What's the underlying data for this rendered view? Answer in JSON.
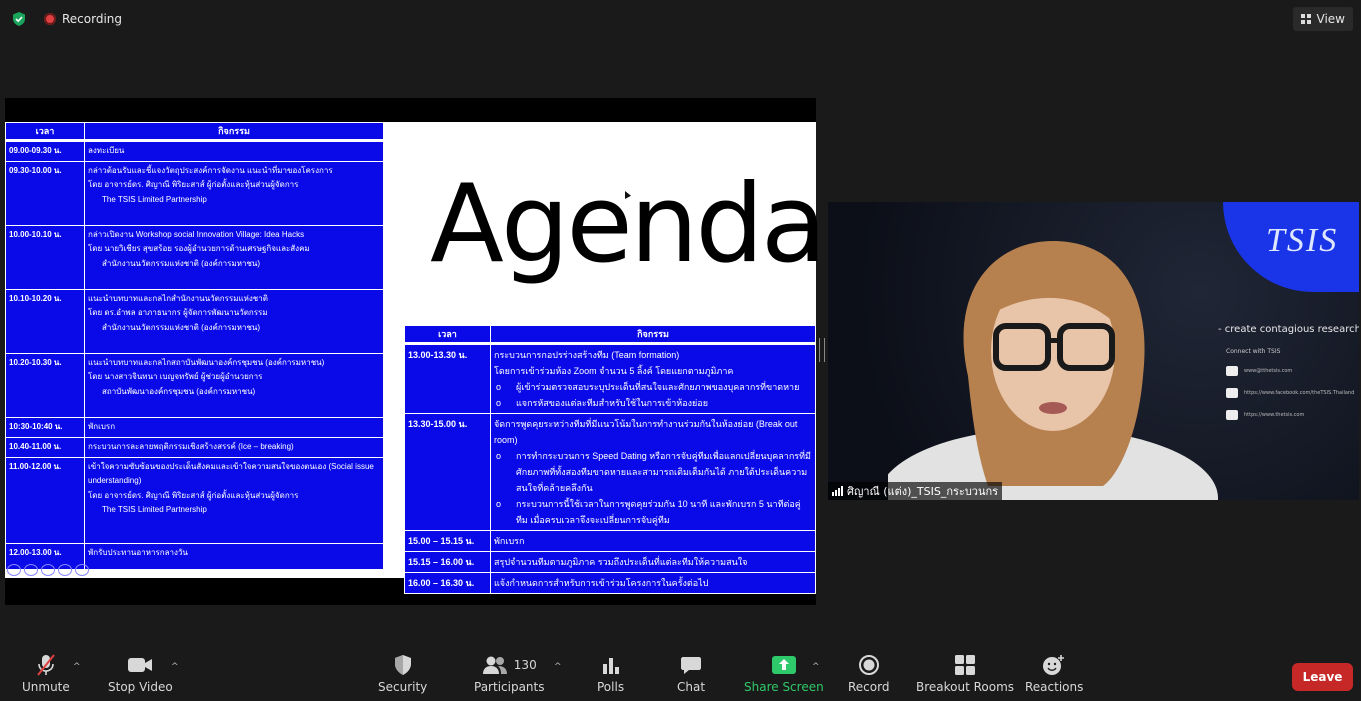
{
  "topbar": {
    "recording": "Recording",
    "view": "View"
  },
  "colors": {
    "accent_green": "#2ec96a",
    "leave_red": "#c62828",
    "slide_blue": "#0a0ae8"
  },
  "slide": {
    "title": "Agenda",
    "left_table": {
      "headers": [
        "เวลา",
        "กิจกรรม"
      ],
      "rows": [
        {
          "time": "09.00-09.30 น.",
          "lines": [
            "ลงทะเบียน"
          ],
          "indent": []
        },
        {
          "time": "09.30-10.00 น.",
          "lines": [
            "กล่าวต้อนรับและชี้แจงวัตถุประสงค์การจัดงาน แนะนำที่มาของโครงการ",
            "โดย อาจารย์ดร. ศิญาณี พิริยะสาส์ ผู้ก่อตั้งและหุ้นส่วนผู้จัดการ"
          ],
          "indent": [
            "The TSIS Limited Partnership"
          ]
        },
        {
          "time": "10.00-10.10 น.",
          "lines": [
            "กล่าวเปิดงาน Workshop social Innovation Village: Idea Hacks",
            "โดย นายวิเชียร สุขสร้อย รองผู้อำนวยการด้านเศรษฐกิจและสังคม"
          ],
          "indent": [
            "สำนักงานนวัตกรรมแห่งชาติ (องค์การมหาชน)"
          ]
        },
        {
          "time": "10.10-10.20 น.",
          "lines": [
            "แนะนำบทบาทและกลไกสำนักงานนวัตกรรมแห่งชาติ",
            "โดย ดร.อำพล อาภาธนากร ผู้จัดการพัฒนานวัตกรรม"
          ],
          "indent": [
            "สำนักงานนวัตกรรมแห่งชาติ (องค์การมหาชน)"
          ]
        },
        {
          "time": "10.20-10.30 น.",
          "lines": [
            "แนะนำบทบาทและกลไกสถาบันพัฒนาองค์กรชุมชน (องค์การมหาชน)",
            "โดย นางสาวจินทนา เบญจทรัพย์ ผู้ช่วยผู้อำนวยการ"
          ],
          "indent": [
            "สถาบันพัฒนาองค์กรชุมชน (องค์การมหาชน)"
          ]
        },
        {
          "time": "10:30-10:40 น.",
          "lines": [
            "พักเบรก"
          ],
          "indent": []
        },
        {
          "time": "10.40-11.00 น.",
          "lines": [
            "กระบวนการละลายพฤติกรรมเชิงสร้างสรรค์ (Ice – breaking)"
          ],
          "indent": []
        },
        {
          "time": "11.00-12.00 น.",
          "lines": [
            "เข้าใจความซับซ้อนของประเด็นสังคมและเข้าใจความสนใจของตนเอง (Social issue understanding)",
            "โดย อาจารย์ดร. ศิญาณี พิริยะสาส์ ผู้ก่อตั้งและหุ้นส่วนผู้จัดการ"
          ],
          "indent": [
            "The TSIS Limited Partnership"
          ]
        },
        {
          "time": "12.00-13.00 น.",
          "lines": [
            "พักรับประทานอาหารกลางวัน"
          ],
          "indent": []
        }
      ]
    },
    "right_table": {
      "headers": [
        "เวลา",
        "กิจกรรม"
      ],
      "rows": [
        {
          "time": "13.00-13.30 น.",
          "lines": [
            "กระบวนการกอปรร่างสร้างทีม (Team formation)",
            "โดยการเข้าร่วมห้อง Zoom จำนวน 5 ลิ้งค์ โดยแยกตามภูมิภาค"
          ],
          "bullets": [
            "ผู้เข้าร่วมตรวจสอบระบุประเด็นที่สนใจและศักยภาพของบุคลากรที่ขาดหาย",
            "แจกรหัสของแต่ละทีมสำหรับใช้ในการเข้าห้องย่อย"
          ]
        },
        {
          "time": "13.30-15.00 น.",
          "lines": [
            "จัดการพูดคุยระหว่างทีมที่มีแนวโน้มในการทำงานร่วมกันในห้องย่อย (Break out room)"
          ],
          "bullets": [
            "การทำกระบวนการ Speed Dating หรือการจับคู่ทีมเพื่อแลกเปลี่ยนบุคลากรที่มีศักยภาพที่ทั้งสองทีมขาดหายและสามารถเติมเต็มกันได้ ภายใต้ประเด็นความสนใจที่คล้ายคลึงกัน",
            "กระบวนการนี้ใช้เวลาในการพูดคุยร่วมกัน 10 นาที และพักเบรก 5 นาทีต่อคู่ทีม เมื่อครบเวลาจึงจะเปลี่ยนการจับคู่ทีม"
          ]
        },
        {
          "time": "15.00 – 15.15 น.",
          "lines": [
            "พักเบรก"
          ],
          "bullets": []
        },
        {
          "time": "15.15 – 16.00 น.",
          "lines": [
            "สรุปจำนวนทีมตามภูมิภาค รวมถึงประเด็นที่แต่ละทีมให้ความสนใจ"
          ],
          "bullets": []
        },
        {
          "time": "16.00 – 16.30 น.",
          "lines": [
            "แจ้งกำหนดการสำหรับการเข้าร่วมโครงการในครั้งต่อไป"
          ],
          "bullets": []
        }
      ]
    }
  },
  "video": {
    "logo": "TSIS",
    "tagline": "- create contagious research culture in Thailand",
    "connect": "Connect with TSIS",
    "contacts": [
      "www@tthetsis.com",
      "https://www.facebook.com/theTSIS.Thailand",
      "https://www.thetsis.com"
    ],
    "participant_name": "ศิญาณี (แต่ง)_TSIS_กระบวนกร"
  },
  "toolbar": {
    "unmute": "Unmute",
    "stop_video": "Stop Video",
    "security": "Security",
    "participants": "Participants",
    "participants_count": "130",
    "polls": "Polls",
    "chat": "Chat",
    "share_screen": "Share Screen",
    "record": "Record",
    "breakout_rooms": "Breakout Rooms",
    "reactions": "Reactions",
    "leave": "Leave"
  }
}
